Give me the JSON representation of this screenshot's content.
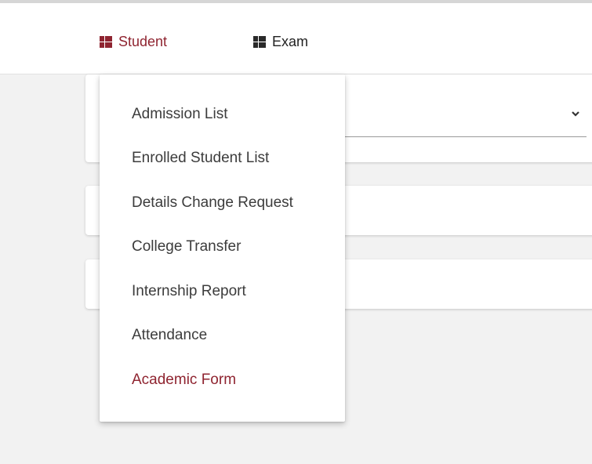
{
  "nav": {
    "items": [
      {
        "label": "Student",
        "icon": "grid-icon",
        "color": "#8f2430",
        "active": true
      },
      {
        "label": "Exam",
        "icon": "grid-icon",
        "color": "#222222",
        "active": false
      }
    ]
  },
  "dropdown": {
    "items": [
      {
        "label": "Admission List"
      },
      {
        "label": "Enrolled Student List"
      },
      {
        "label": "Details Change Request"
      },
      {
        "label": "College Transfer"
      },
      {
        "label": "Internship Report"
      },
      {
        "label": "Attendance"
      },
      {
        "label": "Academic Form",
        "highlighted": true
      }
    ]
  },
  "colors": {
    "accent": "#8f2430",
    "background": "#f2f2f2",
    "menu_text": "#3c3c3c"
  }
}
